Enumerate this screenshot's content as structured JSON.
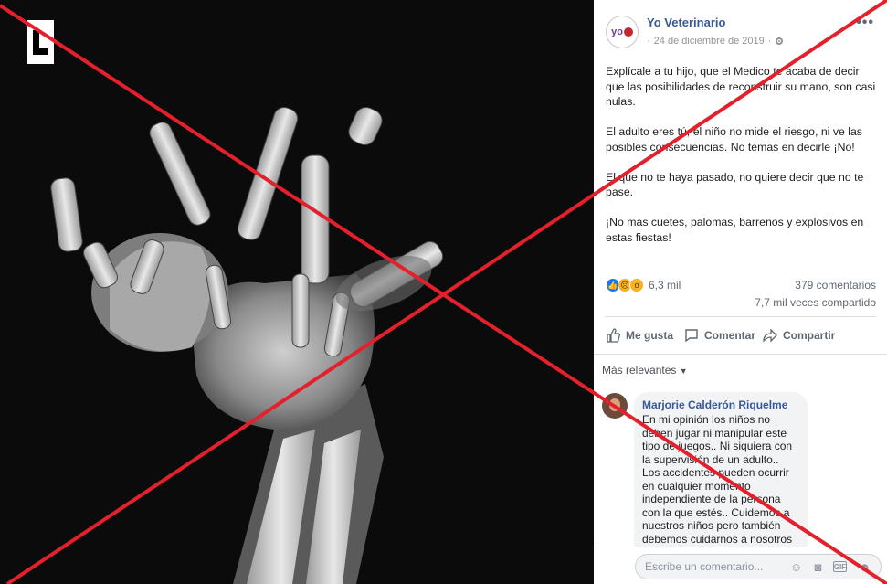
{
  "post": {
    "page_name": "Yo Veterinario",
    "avatar_text": "yo",
    "date": "24 de diciembre de 2019",
    "dot": "·",
    "paragraphs": [
      "Explícale a tu hijo, que el Medico te acaba de decir que las posibilidades de reconstruir su mano, son casi nulas.",
      "El adulto eres tú, el niño no mide el riesgo, ni ve las posibles consecuencias. No temas en decirle ¡No!",
      "El que no te haya pasado, no quiere decir que no te pase.",
      "¡No mas cuetes, palomas, barrenos y explosivos en estas fiestas!"
    ]
  },
  "stats": {
    "reactions_count": "6,3 mil",
    "comments": "379 comentarios",
    "shares": "7,7 mil veces compartido"
  },
  "actions": {
    "like": "Me gusta",
    "comment": "Comentar",
    "share": "Compartir"
  },
  "comments_section": {
    "sort_label": "Más relevantes",
    "comment": {
      "author": "Marjorie Calderón Riquelme",
      "text": "En mi opinión los niños no deben jugar ni manipular este tipo de juegos.. Ni siquiera con la supervisión de un adulto.. Los accidentes pueden ocurrir en cualquier momento independiente de la persona con la que estés.. Cuidemos a nuestros niños pero también debemos cuidarnos a nosotros mismos.. Por eso ni niños ni"
    },
    "composer_placeholder": "Escribe un comentario..."
  },
  "colors": {
    "link_blue": "#385898",
    "overlay_red": "#e3202b",
    "like_blue": "#1877f2"
  },
  "icons": [
    "logo-l-icon",
    "more-icon",
    "settings-gear-icon",
    "like-reaction-icon",
    "sad-reaction-icon",
    "wow-reaction-icon",
    "thumbs-up-icon",
    "comment-icon",
    "share-icon",
    "emoji-icon",
    "camera-icon",
    "gif-icon",
    "sticker-icon"
  ]
}
